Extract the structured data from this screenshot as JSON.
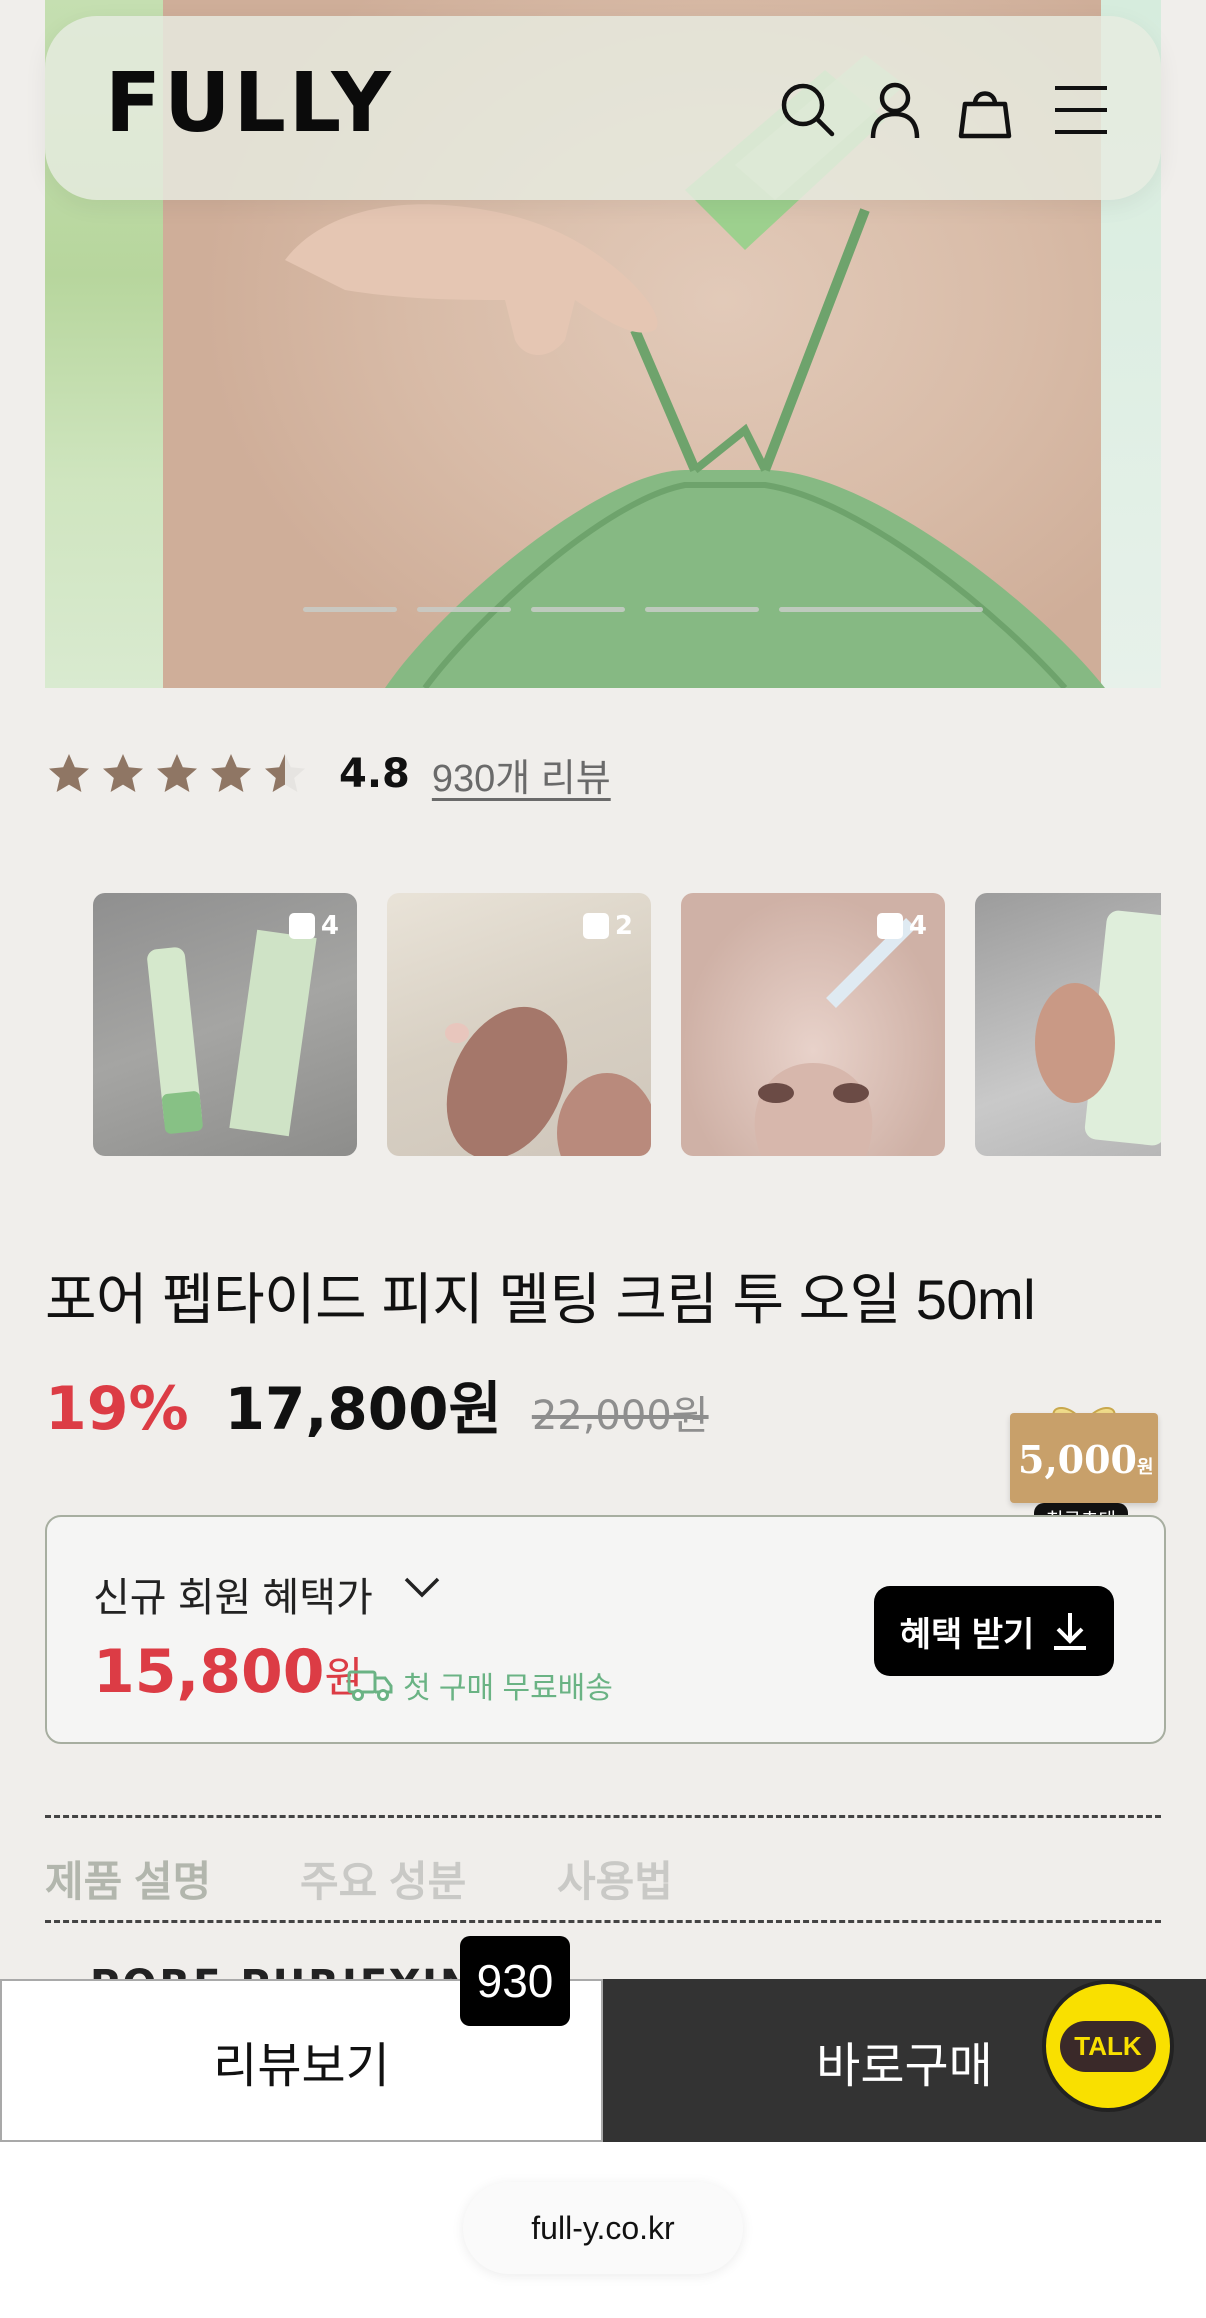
{
  "header": {
    "logo": "FULLY",
    "icons": [
      "search-icon",
      "user-icon",
      "shopping-bag-icon",
      "menu-icon"
    ]
  },
  "hero": {
    "slides_total": 5,
    "active_slide": 5
  },
  "rating": {
    "score": "4.8",
    "stars_value": 4.8,
    "reviews_link": "930개 리뷰"
  },
  "review_photos": [
    {
      "count": "4"
    },
    {
      "count": "2"
    },
    {
      "count": "4"
    },
    {
      "count": ""
    }
  ],
  "product": {
    "title": "포어 펩타이드 피지 멜팅 크림 투 오일 50ml",
    "discount": "19%",
    "price": "17,800원",
    "original_price": "22,000원"
  },
  "coupon": {
    "amount": "5,000",
    "unit": "원",
    "tag": "친구초대"
  },
  "benefit": {
    "label": "신규 회원 혜택가",
    "price": "15,800",
    "price_unit": "원",
    "shipping": "첫 구매 무료배송",
    "button": "혜택 받기"
  },
  "tabs": [
    "제품 설명",
    "주요 성분",
    "사용법"
  ],
  "content_peek": "PORE PURIFYING C",
  "bottom_bar": {
    "review_button": "리뷰보기",
    "review_badge": "930",
    "buy_button": "바로구매",
    "talk_label": "TALK"
  },
  "browser": {
    "url": "full-y.co.kr"
  },
  "colors": {
    "accent_red": "#dc3c45",
    "ship_green": "#6ab384",
    "kakao_yellow": "#f9e000"
  }
}
